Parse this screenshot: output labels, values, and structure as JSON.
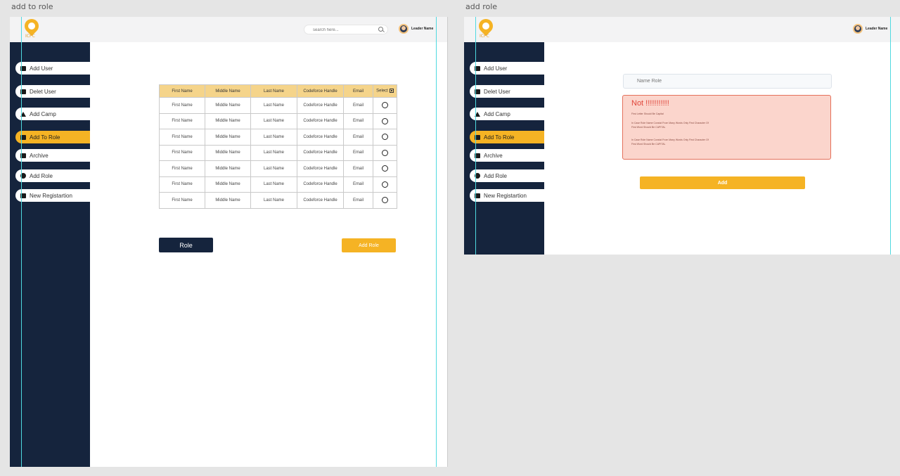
{
  "artboards": {
    "left_label": "add to  role",
    "right_label": "add role"
  },
  "header": {
    "search_placeholder": "search here...",
    "user_name": "Leader Name",
    "logo_text": "ICPC"
  },
  "sidebar": {
    "items": [
      {
        "label": "Add User",
        "icon": "user-icon"
      },
      {
        "label": "Delet User",
        "icon": "user-minus-icon"
      },
      {
        "label": "Add Camp",
        "icon": "tent-icon"
      },
      {
        "label": "Add To Role",
        "icon": "briefcase-icon"
      },
      {
        "label": "Archive",
        "icon": "folder-icon"
      },
      {
        "label": "Add Role",
        "icon": "plus-circle-icon"
      },
      {
        "label": "New Registartion",
        "icon": "id-card-icon"
      }
    ],
    "active_index": 3
  },
  "table": {
    "headers": [
      "First Name",
      "Middle Name",
      "Last Name",
      "Codeforce Handle",
      "Email",
      "Select"
    ],
    "rows": [
      [
        "First Name",
        "Middle Name",
        "Last Name",
        "Codeforce Handle",
        "Email"
      ],
      [
        "First Name",
        "Middle Name",
        "Last Name",
        "Codeforce Handle",
        "Email"
      ],
      [
        "First Name",
        "Middle Name",
        "Last Name",
        "Codeforce Handle",
        "Email"
      ],
      [
        "First Name",
        "Middle Name",
        "Last Name",
        "Codeforce Handle",
        "Email"
      ],
      [
        "First Name",
        "Middle Name",
        "Last Name",
        "Codeforce Handle",
        "Email"
      ],
      [
        "First Name",
        "Middle Name",
        "Last Name",
        "Codeforce Handle",
        "Email"
      ],
      [
        "First Name",
        "Middle Name",
        "Last Name",
        "Codeforce Handle",
        "Email"
      ]
    ]
  },
  "actions": {
    "role_button": "Role",
    "add_role_button": "Add Role"
  },
  "add_role_form": {
    "name_placeholder": "Name Role",
    "error_title": "Not !!!!!!!!!!!",
    "error_lines": [
      "First Letter Should Be Capital",
      "In Case Role Name Consist From Many Words Only First Character Of",
      "First Word Should Be CAPITAL",
      "In Case Role Name Consist From Many Words Only First Character Of",
      "First Word Should Be CAPITAL"
    ],
    "add_button": "Add"
  },
  "colors": {
    "sidebar": "#15243d",
    "accent": "#f5b324",
    "table_header": "#f5d48a",
    "error_bg": "#fbd5cc",
    "error_text": "#e0453a",
    "guide": "#4fd9e0"
  }
}
